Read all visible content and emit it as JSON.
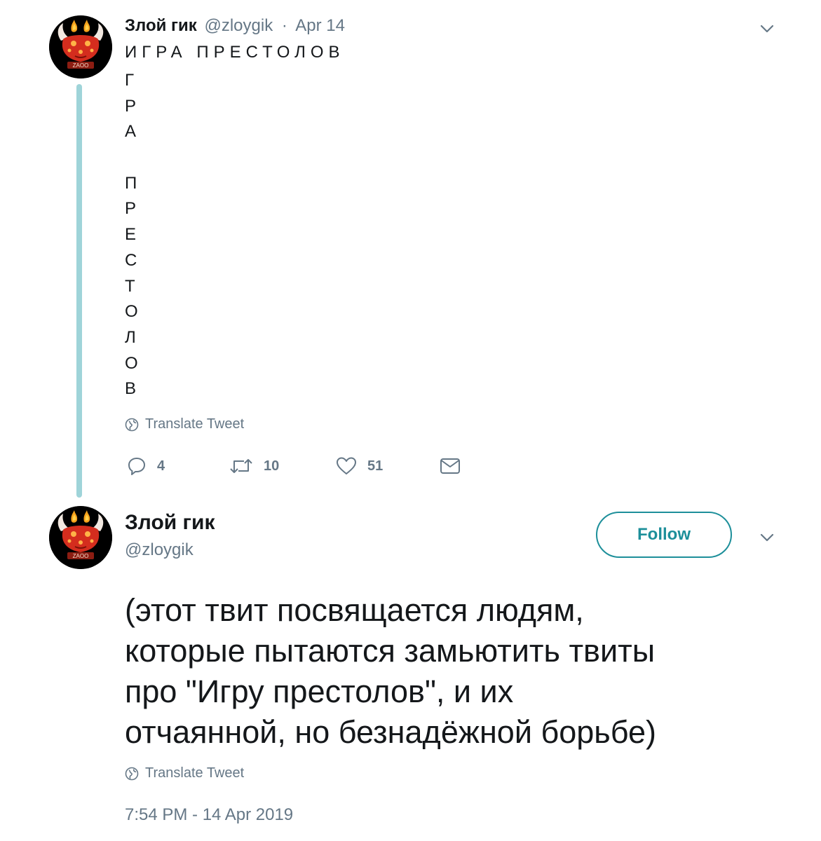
{
  "tweet1": {
    "author_name": "Злой гик",
    "handle": "@zloygik",
    "separator": "·",
    "date": "Apr 14",
    "title_line": "ИГРА ПРЕСТОЛОВ",
    "vertical_letters": [
      "Г",
      "Р",
      "А",
      "",
      "П",
      "Р",
      "Е",
      "С",
      "Т",
      "О",
      "Л",
      "О",
      "В"
    ],
    "translate_label": "Translate Tweet",
    "actions": {
      "reply_count": "4",
      "retweet_count": "10",
      "like_count": "51"
    }
  },
  "tweet2": {
    "author_name": "Злой гик",
    "handle": "@zloygik",
    "follow_label": "Follow",
    "text_lines": [
      "(этот твит посвящается людям,",
      "которые пытаются замьютить твиты",
      "про \"Игру престолов\", и их",
      "отчаянной, но безнадёжной борьбе)"
    ],
    "translate_label": "Translate Tweet",
    "timestamp": "7:54 PM - 14 Apr 2019"
  },
  "avatar": {
    "badge_text": "ZAOO"
  },
  "icons": {
    "reply": "reply-icon",
    "retweet": "retweet-icon",
    "like": "heart-icon",
    "dm": "envelope-icon",
    "more": "chevron-down-icon",
    "translate": "globe-icon"
  },
  "colors": {
    "text_primary": "#14171a",
    "text_secondary": "#657786",
    "accent": "#1d8f9a",
    "thread_line": "#9fd4d9"
  }
}
